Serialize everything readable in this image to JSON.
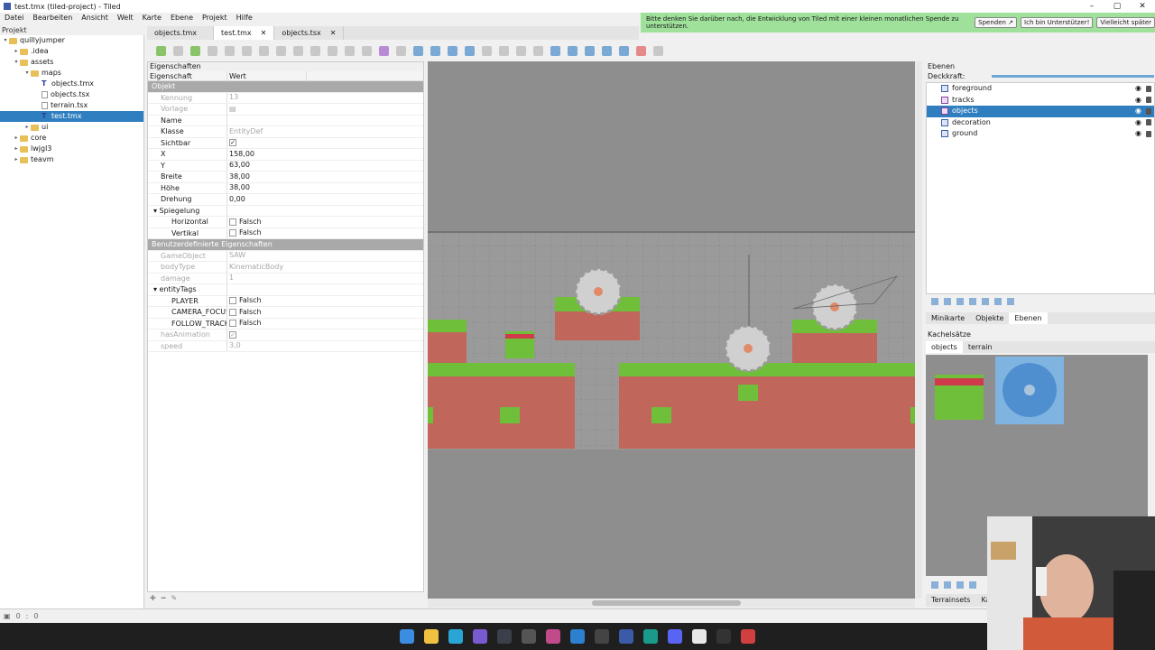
{
  "window": {
    "title": "test.tmx (tiled-project) - Tiled",
    "controls": [
      "–",
      "▢",
      "✕"
    ]
  },
  "menu": [
    "Datei",
    "Bearbeiten",
    "Ansicht",
    "Welt",
    "Karte",
    "Ebene",
    "Projekt",
    "Hilfe"
  ],
  "donate": {
    "message": "Bitte denken Sie darüber nach, die Entwicklung von Tiled mit einer kleinen monatlichen Spende zu unterstützen.",
    "donate_btn": "Spenden ↗",
    "supporter_btn": "Ich bin Unterstützer!",
    "later_btn": "Vielleicht später"
  },
  "project": {
    "header": "Projekt",
    "tree": [
      {
        "label": "quillyjumper",
        "level": 0,
        "kind": "folder",
        "arrow": "▾"
      },
      {
        "label": ".idea",
        "level": 1,
        "kind": "folder",
        "arrow": "▸"
      },
      {
        "label": "assets",
        "level": 1,
        "kind": "folder",
        "arrow": "▾"
      },
      {
        "label": "maps",
        "level": 2,
        "kind": "folder",
        "arrow": "▾"
      },
      {
        "label": "objects.tmx",
        "level": 3,
        "kind": "tmx",
        "arrow": ""
      },
      {
        "label": "objects.tsx",
        "level": 3,
        "kind": "tsx",
        "arrow": ""
      },
      {
        "label": "terrain.tsx",
        "level": 3,
        "kind": "tsx",
        "arrow": ""
      },
      {
        "label": "test.tmx",
        "level": 3,
        "kind": "tmx",
        "arrow": "",
        "selected": true
      },
      {
        "label": "ui",
        "level": 2,
        "kind": "folder",
        "arrow": "▸"
      },
      {
        "label": "core",
        "level": 1,
        "kind": "folder",
        "arrow": "▸"
      },
      {
        "label": "lwjgl3",
        "level": 1,
        "kind": "folder",
        "arrow": "▸"
      },
      {
        "label": "teavm",
        "level": 1,
        "kind": "folder",
        "arrow": "▸"
      }
    ]
  },
  "tabs": [
    {
      "label": "objects.tmx",
      "active": false,
      "close": ""
    },
    {
      "label": "test.tmx",
      "active": true,
      "close": "✕"
    },
    {
      "label": "objects.tsx",
      "active": false,
      "close": "✕"
    }
  ],
  "properties": {
    "header": "Eigenschaften",
    "col_key": "Eigenschaft",
    "col_value": "Wert",
    "rows": [
      {
        "k": "Objekt",
        "v": "",
        "type": "group"
      },
      {
        "k": "Kennung",
        "v": "13",
        "type": "dis"
      },
      {
        "k": "Vorlage",
        "v": "▤",
        "type": "dis"
      },
      {
        "k": "Name",
        "v": "",
        "type": "normal"
      },
      {
        "k": "Klasse",
        "v": "EntityDef",
        "type": "dimval"
      },
      {
        "k": "Sichtbar",
        "v": "✓",
        "type": "check"
      },
      {
        "k": "X",
        "v": "158,00",
        "type": "normal"
      },
      {
        "k": "Y",
        "v": "63,00",
        "type": "normal"
      },
      {
        "k": "Breite",
        "v": "38,00",
        "type": "normal"
      },
      {
        "k": "Höhe",
        "v": "38,00",
        "type": "normal"
      },
      {
        "k": "Drehung",
        "v": "0,00",
        "type": "normal"
      },
      {
        "k": "▾ Spiegelung",
        "v": "",
        "type": "sub"
      },
      {
        "k": "Horizontal",
        "v": "Falsch",
        "type": "deepcheck"
      },
      {
        "k": "Vertikal",
        "v": "Falsch",
        "type": "deepcheck"
      },
      {
        "k": "Benutzerdefinierte Eigenschaften",
        "v": "",
        "type": "group"
      },
      {
        "k": "GameObject",
        "v": "SAW",
        "type": "dis"
      },
      {
        "k": "bodyType",
        "v": "KinematicBody",
        "type": "dis"
      },
      {
        "k": "damage",
        "v": "1",
        "type": "dis"
      },
      {
        "k": "▾ entityTags",
        "v": "",
        "type": "sub"
      },
      {
        "k": "PLAYER",
        "v": "Falsch",
        "type": "deepcheck"
      },
      {
        "k": "CAMERA_FOCUS",
        "v": "Falsch",
        "type": "deepcheck"
      },
      {
        "k": "FOLLOW_TRACK",
        "v": "Falsch",
        "type": "deepcheck"
      },
      {
        "k": "hasAnimation",
        "v": "✓",
        "type": "dischk"
      },
      {
        "k": "speed",
        "v": "3,0",
        "type": "dis"
      }
    ]
  },
  "layers": {
    "header": "Ebenen",
    "opacity_label": "Deckkraft:",
    "items": [
      {
        "label": "foreground",
        "type": "tile",
        "selected": false
      },
      {
        "label": "tracks",
        "type": "object",
        "selected": false
      },
      {
        "label": "objects",
        "type": "object",
        "selected": true
      },
      {
        "label": "decoration",
        "type": "tile",
        "selected": false
      },
      {
        "label": "ground",
        "type": "tile",
        "selected": false
      }
    ]
  },
  "lowtabs": [
    "Minikarte",
    "Objekte",
    "Ebenen"
  ],
  "tilesets": {
    "header": "Kachelsätze",
    "tabs": [
      "objects",
      "terrain"
    ]
  },
  "bottabs": [
    "Terrainsets",
    "Ka"
  ],
  "status": {
    "zoom": "0",
    "coords": "0"
  },
  "colors": {
    "select": "#2f7fc0",
    "donate_bg": "#9fe09a",
    "grass": "#6fbf3a",
    "dirt": "#c0665a",
    "saw": "#d0d0d0",
    "canvas_bg": "#8e8e8e"
  }
}
